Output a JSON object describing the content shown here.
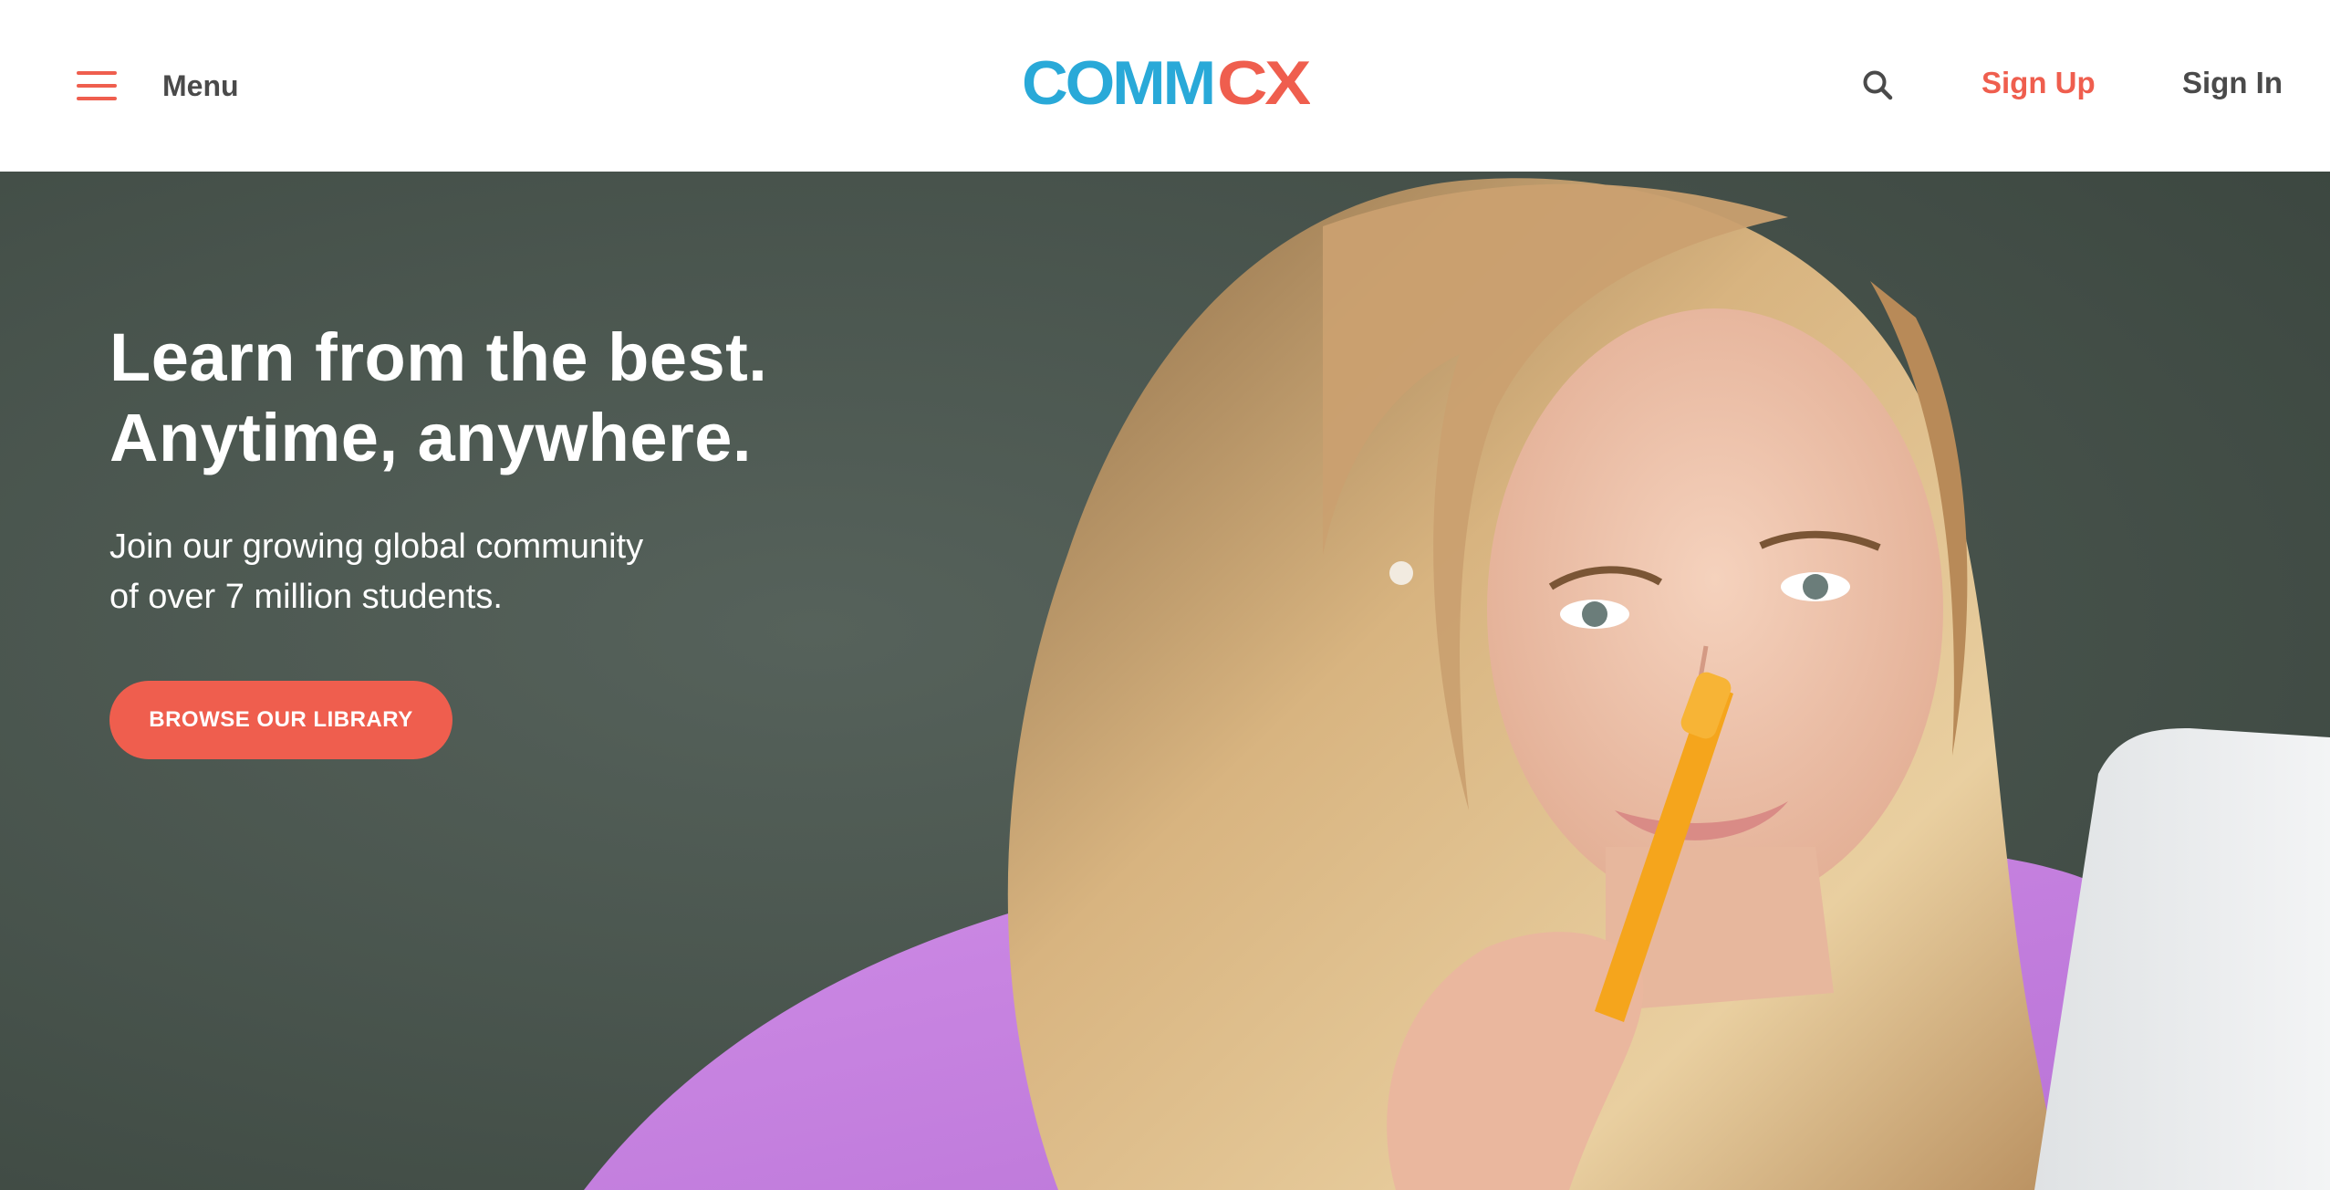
{
  "header": {
    "menu_label": "Menu",
    "logo": {
      "text_part1": "COMM",
      "text_part2": "CX",
      "color_primary": "#29a9d8",
      "color_secondary": "#ef5e4e"
    },
    "search_icon": "search-icon",
    "signup_label": "Sign Up",
    "signin_label": "Sign In"
  },
  "hero": {
    "headline_line1": "Learn from the best.",
    "headline_line2": "Anytime, anywhere.",
    "subhead_line1": "Join our growing global community",
    "subhead_line2": "of over 7 million students.",
    "cta_label": "BROWSE OUR LIBRARY",
    "image_subject": "student-with-pen-photo"
  },
  "colors": {
    "accent": "#ef5e4e",
    "brand_blue": "#29a9d8",
    "nav_text": "#4a4a4a",
    "hero_bg": "#44504a"
  }
}
